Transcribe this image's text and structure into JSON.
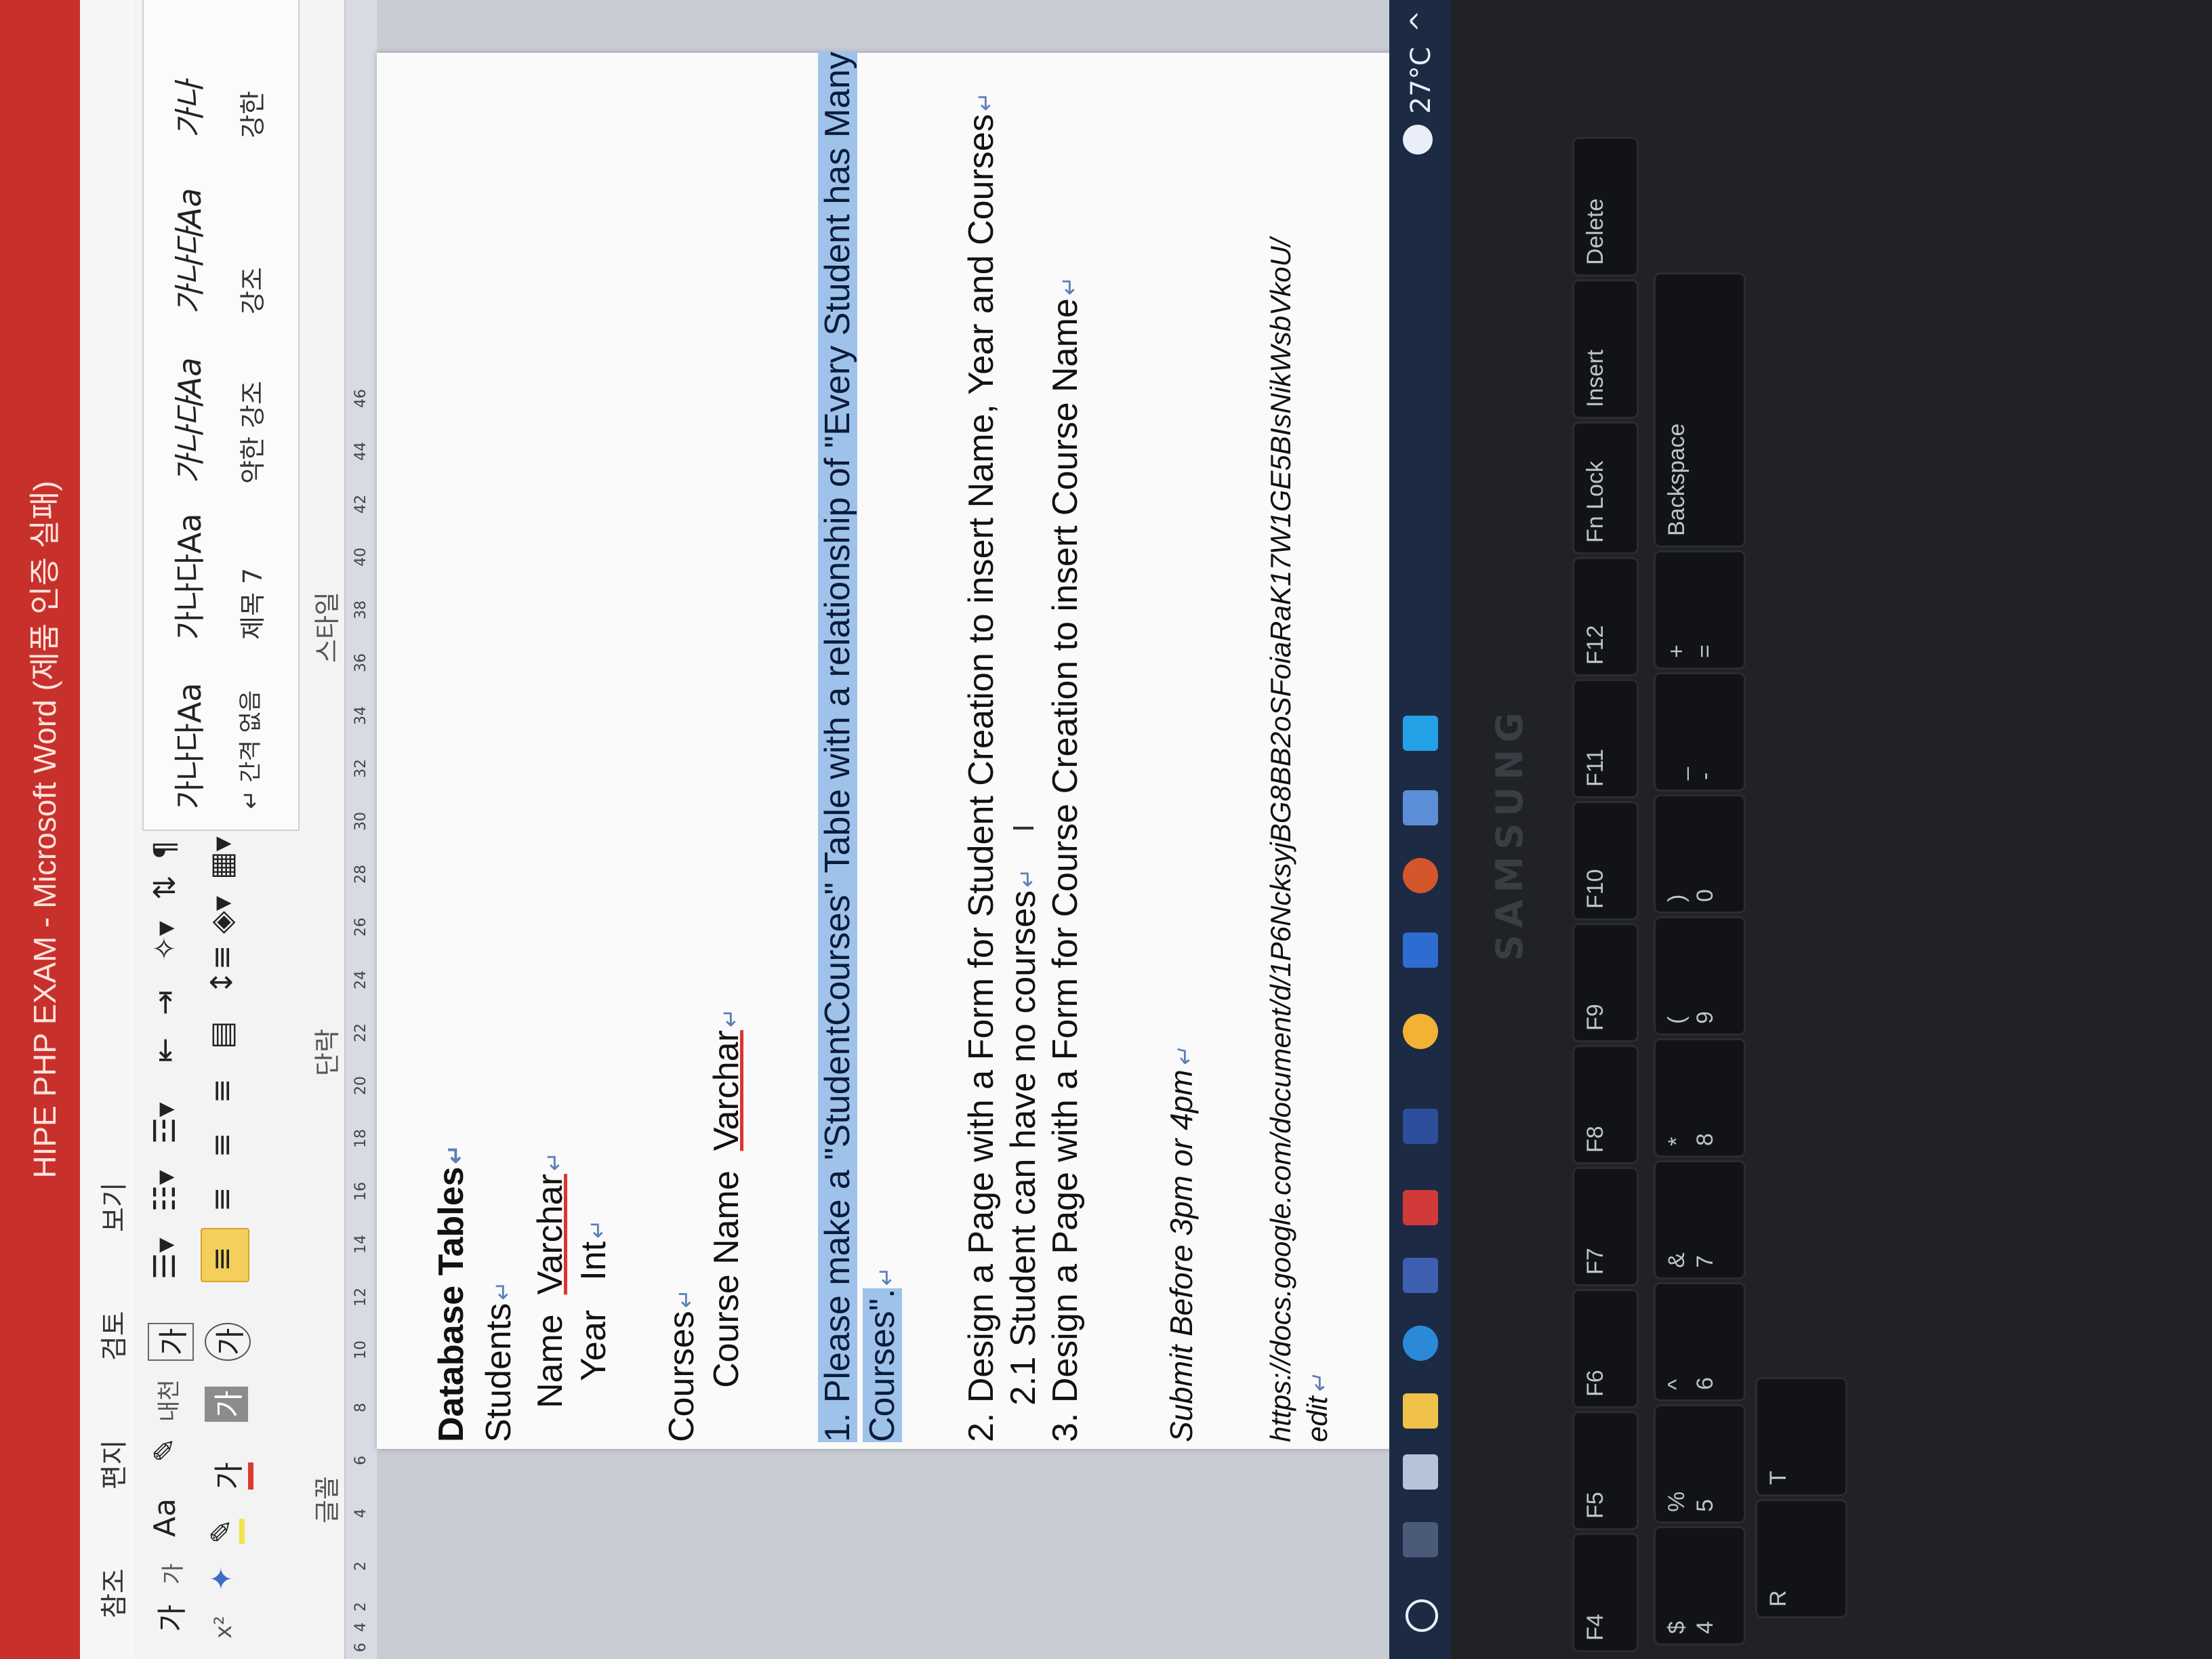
{
  "window": {
    "title": "HIPE PHP EXAM  -  Microsoft Word (제품 인증 실패)"
  },
  "tabs": [
    "참조",
    "편지",
    "검토",
    "보기"
  ],
  "ribbon": {
    "groups": {
      "font": "글꼴",
      "paragraph": "단락",
      "styles": "스타일"
    },
    "font_tools": [
      "가",
      "가",
      "Aa",
      "가",
      "가",
      "x²",
      "가",
      "가",
      "가",
      "가"
    ],
    "style_gallery": [
      {
        "sample": "가나다Aa",
        "name": "↵ 간격 없음"
      },
      {
        "sample": "가나다Aa",
        "name": "제목 7"
      },
      {
        "sample": "가나다Aa",
        "name": "약한 강조"
      },
      {
        "sample": "가나다Aa",
        "name": "강조"
      },
      {
        "sample": "가나",
        "name": "강한"
      }
    ]
  },
  "ruler": {
    "ticks": [
      "6",
      "4",
      "2",
      "",
      "2",
      "4",
      "6",
      "8",
      "10",
      "12",
      "14",
      "16",
      "18",
      "20",
      "22",
      "24",
      "26",
      "28",
      "30",
      "32",
      "34",
      "36",
      "38",
      "40",
      "42",
      "44",
      "46"
    ]
  },
  "document": {
    "heading": "Database Tables",
    "students_label": "Students",
    "student_fields": [
      {
        "name": "Name",
        "type": "Varchar"
      },
      {
        "name": "Year",
        "type": "Int"
      }
    ],
    "courses_label": "Courses",
    "course_fields": [
      {
        "name": "Course Name",
        "type": "Varchar"
      }
    ],
    "task1_a": "1. Please make a \"StudentCourses\" Table with a relationship  of \"Every Student has Many",
    "task1_b": "Courses\".",
    "task2": "2. Design a Page with a Form for Student Creation to insert Name, Year and Courses",
    "task2_1": "2.1 Student can have no courses",
    "task3": "3. Design a Page with a Form for Course Creation to insert Course Name",
    "submit": "Submit Before 3pm or 4pm",
    "link_a": "https://docs.google.com/document/d/1P6NcksyjBG8BB2oSFoiaRaK17W1GE5BIsNikWsbVkoU/",
    "link_b": "edit"
  },
  "taskbar": {
    "temperature": "27°C"
  },
  "laptop": {
    "brand": "SAMSUNG",
    "fkeys": [
      "F4",
      "F5",
      "F6",
      "F7",
      "F8",
      "F9",
      "F10",
      "F11",
      "F12"
    ],
    "number_keys": [
      {
        "top": "$",
        "bottom": "4"
      },
      {
        "top": "%",
        "bottom": "5"
      },
      {
        "top": "^",
        "bottom": "6"
      },
      {
        "top": "&",
        "bottom": "7"
      },
      {
        "top": "*",
        "bottom": "8"
      },
      {
        "top": "(",
        "bottom": "9"
      },
      {
        "top": ")",
        "bottom": "0"
      },
      {
        "top": "_",
        "bottom": "-"
      },
      {
        "top": "+",
        "bottom": "="
      }
    ],
    "special_keys": [
      "Fn Lock",
      "Insert",
      "Delete",
      "Backspace"
    ],
    "letter_keys": [
      "R",
      "T"
    ]
  },
  "colors": {
    "titlebar": "#c8302c",
    "selection": "#9fc2ea",
    "taskbar": "#1d2a44"
  }
}
